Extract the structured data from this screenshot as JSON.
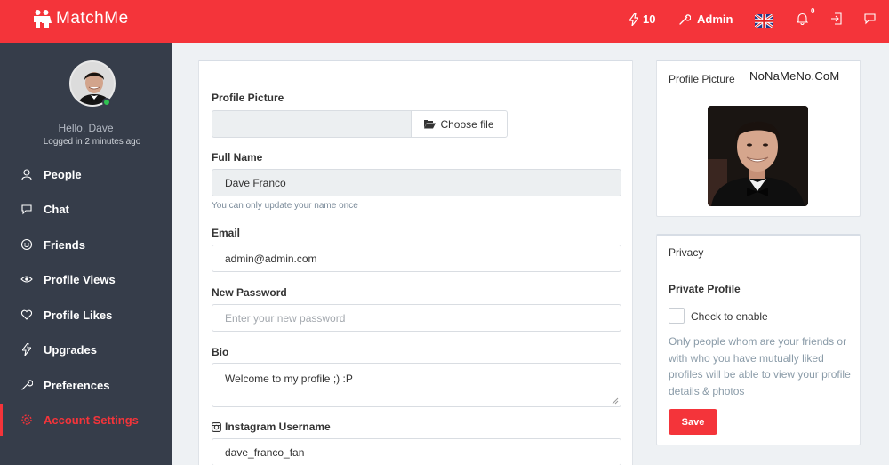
{
  "colors": {
    "brand": "#f4343a",
    "sidebar": "#363d4a",
    "online": "#2fc351"
  },
  "topbar": {
    "app_name": "MatchMe",
    "credits": "10",
    "admin_label": "Admin",
    "notification_count": "0",
    "icons": [
      "bolt-icon",
      "wrench-icon",
      "uk-flag-icon",
      "bell-icon",
      "logout-icon",
      "chat-bubble-icon"
    ]
  },
  "sidebar": {
    "greeting": "Hello, Dave",
    "last_login": "Logged in 2 minutes ago",
    "items": [
      {
        "label": "People",
        "icon": "people-icon"
      },
      {
        "label": "Chat",
        "icon": "chat-icon"
      },
      {
        "label": "Friends",
        "icon": "smiley-icon"
      },
      {
        "label": "Profile Views",
        "icon": "eye-icon"
      },
      {
        "label": "Profile Likes",
        "icon": "heart-icon"
      },
      {
        "label": "Upgrades",
        "icon": "bolt-icon"
      },
      {
        "label": "Preferences",
        "icon": "wrench-icon"
      },
      {
        "label": "Account Settings",
        "icon": "gear-icon",
        "active": true
      }
    ]
  },
  "form": {
    "profile_picture_label": "Profile Picture",
    "choose_file_label": "Choose file",
    "full_name_label": "Full Name",
    "full_name_value": "Dave Franco",
    "full_name_hint": "You can only update your name once",
    "email_label": "Email",
    "email_value": "admin@admin.com",
    "new_password_label": "New Password",
    "new_password_placeholder": "Enter your new password",
    "bio_label": "Bio",
    "bio_value": "Welcome to my profile ;) :P",
    "instagram_label": "Instagram Username",
    "instagram_value": "dave_franco_fan"
  },
  "profile_card": {
    "title": "Profile Picture",
    "watermark": "NoNaMeNo.CoM"
  },
  "privacy_card": {
    "title": "Privacy",
    "private_profile_label": "Private Profile",
    "checkbox_label": "Check to enable",
    "checked": false,
    "description": "Only people whom are your friends or with who you have mutually liked profiles will be able to view your profile details & photos",
    "save_label": "Save"
  }
}
